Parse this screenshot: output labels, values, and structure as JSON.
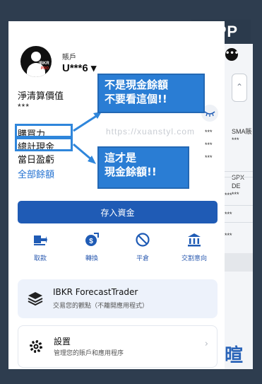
{
  "badge": "APP",
  "account": {
    "label": "賬戶",
    "id": "U***6 ▾"
  },
  "balances": {
    "net_liq_label": "淨清算價值",
    "net_liq_value": "***",
    "buying_power_label": "購買力",
    "buying_power_value": "***",
    "total_cash_label": "總計現金",
    "total_cash_value": "***",
    "day_pnl_label": "當日盈虧",
    "day_pnl_value": "***",
    "all_balances_link": "全部餘額"
  },
  "deposit_button": "存入資金",
  "actions": [
    {
      "label": "取款",
      "icon": "withdraw-icon"
    },
    {
      "label": "轉換",
      "icon": "currency-exchange-icon"
    },
    {
      "label": "平倉",
      "icon": "close-position-icon"
    },
    {
      "label": "交割意向",
      "icon": "bank-icon"
    }
  ],
  "forecast_card": {
    "title": "IBKR ForecastTrader",
    "subtitle": "交易您的觀點（不離開應用程式）"
  },
  "settings_card": {
    "title": "設置",
    "subtitle": "管理您的賬戶和應用程序"
  },
  "annotations": {
    "callout_top": [
      "不是現金餘額",
      "不要看這個!!"
    ],
    "callout_bottom": [
      "這才是",
      "現金餘額!!"
    ],
    "watermark": "https://xuanstyl.com"
  },
  "background_app": {
    "menu": "•••",
    "sma": "SMA賬",
    "spx": "SPX DE",
    "stars": "***",
    "big_char": "暄"
  },
  "colors": {
    "brand_blue": "#1f5bb5",
    "callout_blue": "#2a7dd4",
    "frame_blue": "#2f86db",
    "page_bg": "#2e3d4f"
  }
}
